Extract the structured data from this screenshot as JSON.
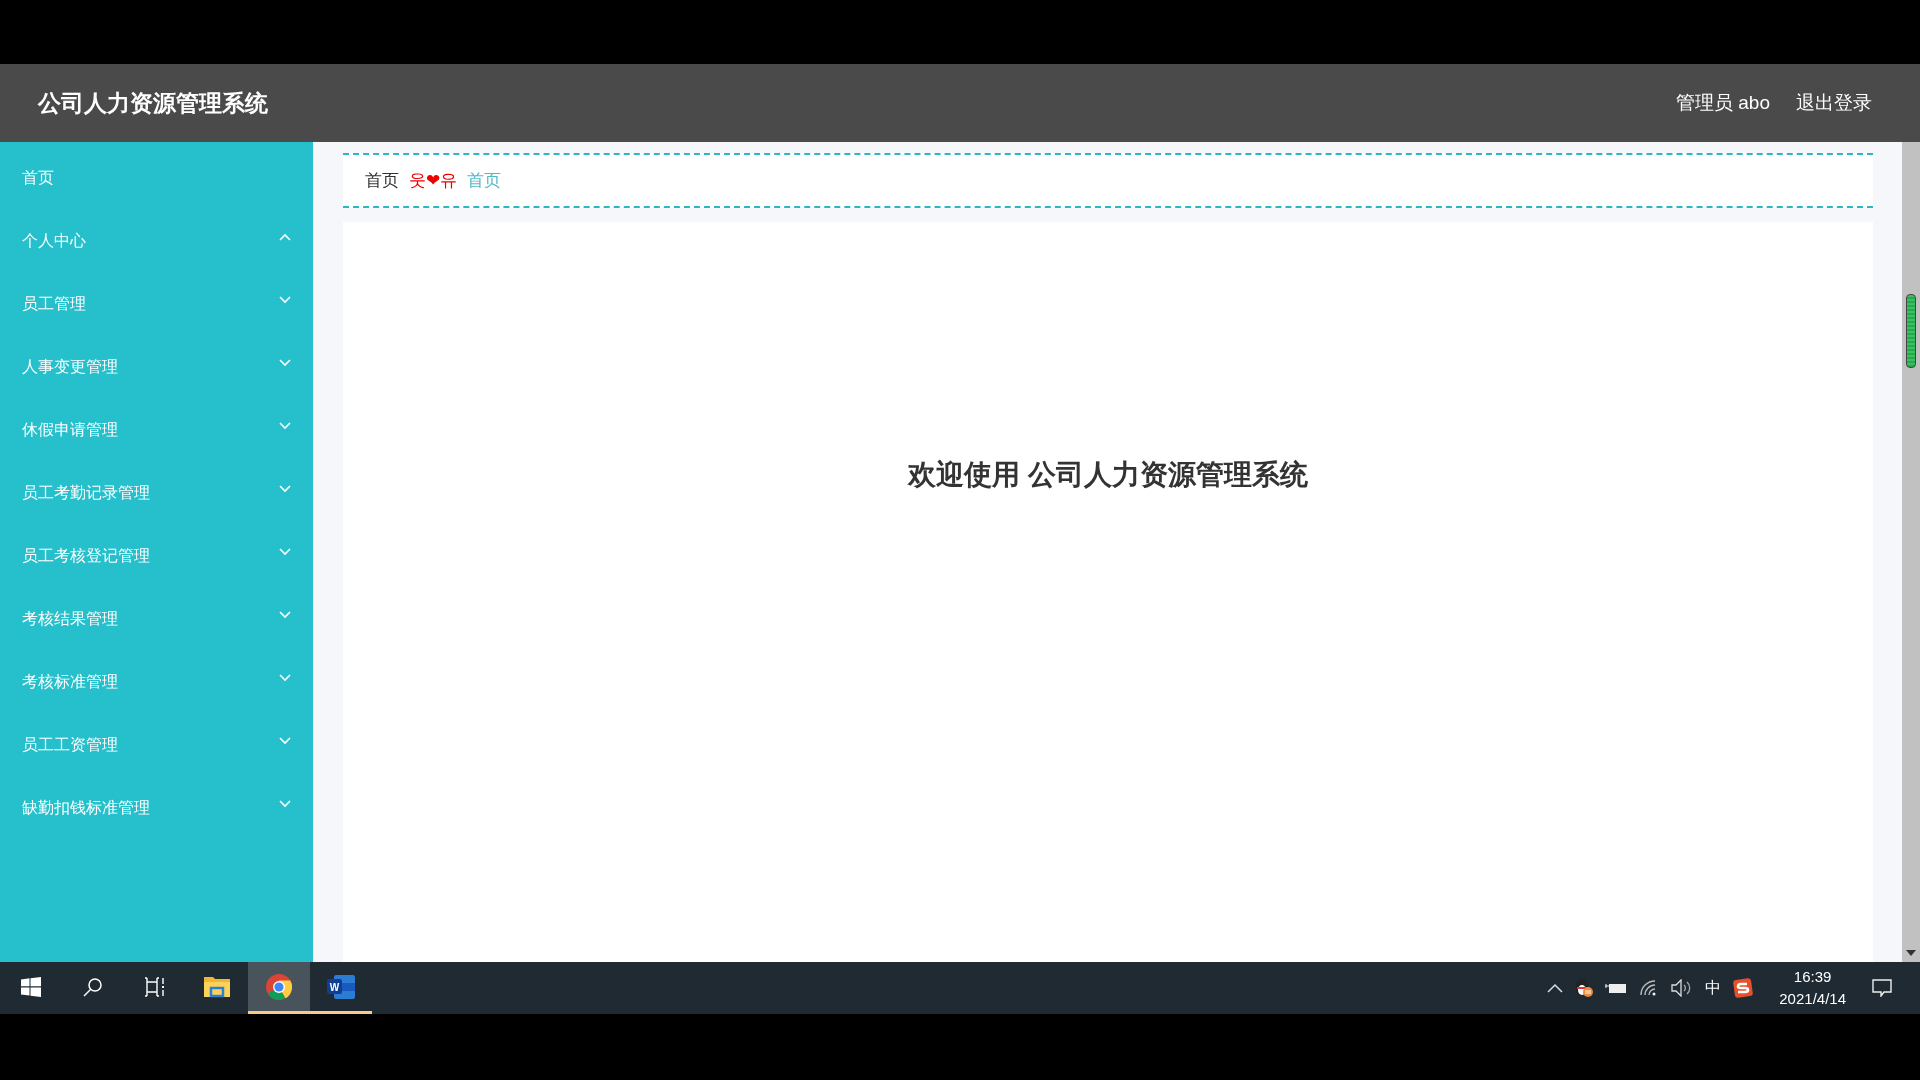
{
  "header": {
    "title": "公司人力资源管理系统",
    "user": "管理员 abo",
    "logout": "退出登录"
  },
  "sidebar": {
    "items": [
      {
        "label": "首页",
        "kind": "link"
      },
      {
        "label": "个人中心",
        "kind": "menu",
        "expanded": true
      },
      {
        "label": "员工管理",
        "kind": "menu",
        "expanded": false
      },
      {
        "label": "人事变更管理",
        "kind": "menu",
        "expanded": false
      },
      {
        "label": "休假申请管理",
        "kind": "menu",
        "expanded": false
      },
      {
        "label": "员工考勤记录管理",
        "kind": "menu",
        "expanded": false
      },
      {
        "label": "员工考核登记管理",
        "kind": "menu",
        "expanded": false
      },
      {
        "label": "考核结果管理",
        "kind": "menu",
        "expanded": false
      },
      {
        "label": "考核标准管理",
        "kind": "menu",
        "expanded": false
      },
      {
        "label": "员工工资管理",
        "kind": "menu",
        "expanded": false
      },
      {
        "label": "缺勤扣钱标准管理",
        "kind": "menu",
        "expanded": false
      }
    ]
  },
  "breadcrumb": {
    "items": [
      "首页",
      "首页"
    ],
    "separator": "웃❤유"
  },
  "welcome": "欢迎使用 公司人力资源管理系统",
  "taskbar": {
    "apps": [
      {
        "kind": "start",
        "selected": false,
        "running": false
      },
      {
        "kind": "search",
        "selected": false,
        "running": false
      },
      {
        "kind": "taskview",
        "selected": false,
        "running": false
      },
      {
        "kind": "explorer",
        "selected": false,
        "running": false
      },
      {
        "kind": "chrome",
        "selected": true,
        "running": true
      },
      {
        "kind": "word",
        "selected": false,
        "running": true,
        "label": "W"
      }
    ],
    "tray": {
      "ime": "中",
      "time": "16:39",
      "date": "2021/4/14"
    }
  }
}
